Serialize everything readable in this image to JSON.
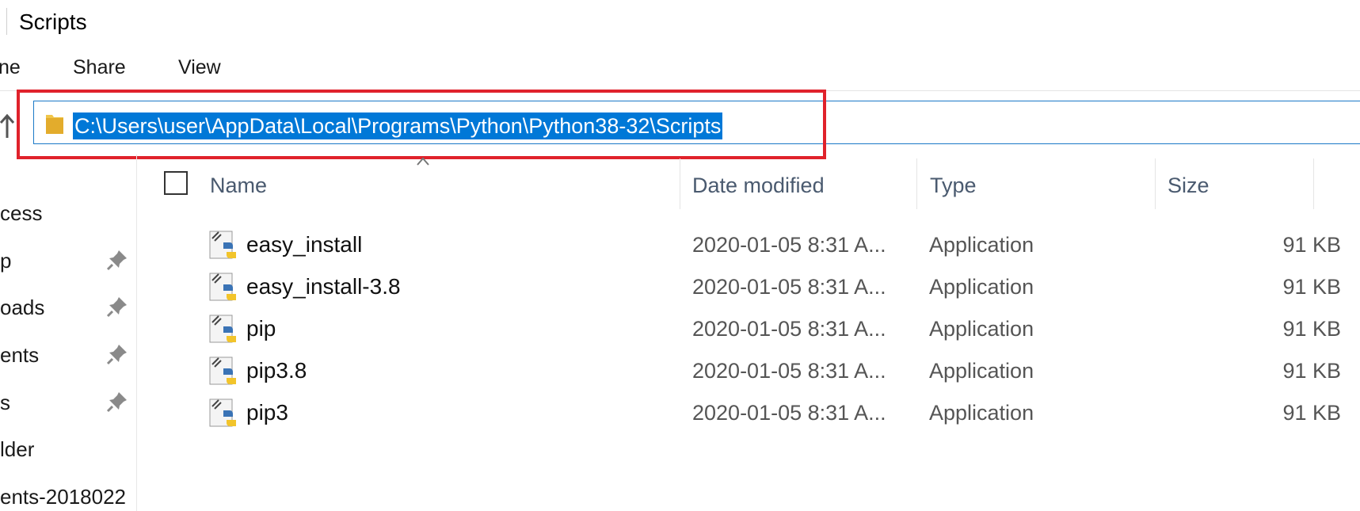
{
  "window": {
    "title": "Scripts"
  },
  "ribbon": {
    "tabs": [
      {
        "label": "ne"
      },
      {
        "label": "Share"
      },
      {
        "label": "View"
      }
    ]
  },
  "address_bar": {
    "path": "C:\\Users\\user\\AppData\\Local\\Programs\\Python\\Python38-32\\Scripts",
    "highlight_color": "#e0222b",
    "selection_color": "#0078d7"
  },
  "nav_pane": {
    "items": [
      {
        "label": "cess",
        "pinned": false
      },
      {
        "label": "p",
        "pinned": true
      },
      {
        "label": "oads",
        "pinned": true
      },
      {
        "label": "ents",
        "pinned": true
      },
      {
        "label": "s",
        "pinned": true
      },
      {
        "label": "lder",
        "pinned": false
      },
      {
        "label": "ents-2018022",
        "pinned": false
      }
    ]
  },
  "file_list": {
    "columns": {
      "name": "Name",
      "date_modified": "Date modified",
      "type": "Type",
      "size": "Size"
    },
    "rows": [
      {
        "name": "easy_install",
        "date": "2020-01-05 8:31 A...",
        "type": "Application",
        "size": "91 KB",
        "icon": "python-exe-icon"
      },
      {
        "name": "easy_install-3.8",
        "date": "2020-01-05 8:31 A...",
        "type": "Application",
        "size": "91 KB",
        "icon": "python-exe-icon"
      },
      {
        "name": "pip",
        "date": "2020-01-05 8:31 A...",
        "type": "Application",
        "size": "91 KB",
        "icon": "python-exe-icon"
      },
      {
        "name": "pip3.8",
        "date": "2020-01-05 8:31 A...",
        "type": "Application",
        "size": "91 KB",
        "icon": "python-exe-icon"
      },
      {
        "name": "pip3",
        "date": "2020-01-05 8:31 A...",
        "type": "Application",
        "size": "91 KB",
        "icon": "python-exe-icon"
      }
    ]
  }
}
